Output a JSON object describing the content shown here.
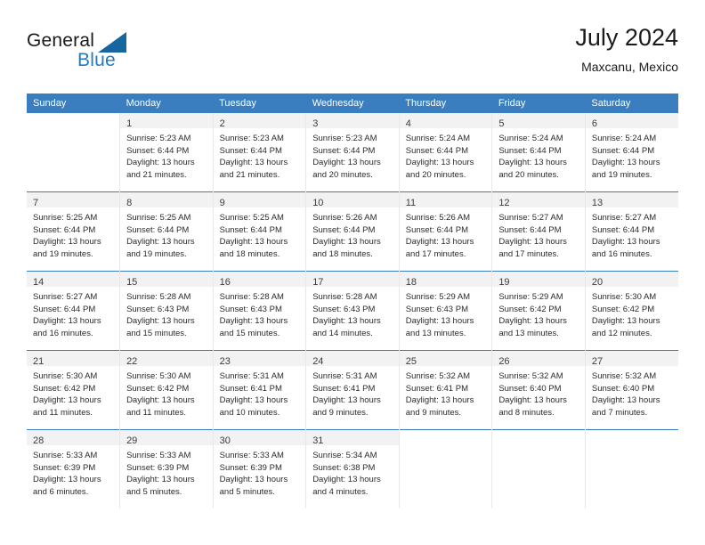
{
  "brand": {
    "name_top": "General",
    "name_bottom": "Blue",
    "accent_color": "#15659e",
    "blue_text_color": "#1f7ac4"
  },
  "header": {
    "title": "July 2024",
    "subtitle": "Maxcanu, Mexico"
  },
  "theme": {
    "header_bg": "#3a7ebf",
    "header_text": "#ffffff",
    "daynum_band_bg": "#f2f2f2",
    "row_divider": "#3a7ebf",
    "cell_divider": "#e8e8e8"
  },
  "calendar": {
    "weekday_headers": [
      "Sunday",
      "Monday",
      "Tuesday",
      "Wednesday",
      "Thursday",
      "Friday",
      "Saturday"
    ],
    "weeks": [
      [
        {
          "blank": true
        },
        {
          "day": "1",
          "sunrise": "Sunrise: 5:23 AM",
          "sunset": "Sunset: 6:44 PM",
          "daylight": "Daylight: 13 hours and 21 minutes."
        },
        {
          "day": "2",
          "sunrise": "Sunrise: 5:23 AM",
          "sunset": "Sunset: 6:44 PM",
          "daylight": "Daylight: 13 hours and 21 minutes."
        },
        {
          "day": "3",
          "sunrise": "Sunrise: 5:23 AM",
          "sunset": "Sunset: 6:44 PM",
          "daylight": "Daylight: 13 hours and 20 minutes."
        },
        {
          "day": "4",
          "sunrise": "Sunrise: 5:24 AM",
          "sunset": "Sunset: 6:44 PM",
          "daylight": "Daylight: 13 hours and 20 minutes."
        },
        {
          "day": "5",
          "sunrise": "Sunrise: 5:24 AM",
          "sunset": "Sunset: 6:44 PM",
          "daylight": "Daylight: 13 hours and 20 minutes."
        },
        {
          "day": "6",
          "sunrise": "Sunrise: 5:24 AM",
          "sunset": "Sunset: 6:44 PM",
          "daylight": "Daylight: 13 hours and 19 minutes."
        }
      ],
      [
        {
          "day": "7",
          "sunrise": "Sunrise: 5:25 AM",
          "sunset": "Sunset: 6:44 PM",
          "daylight": "Daylight: 13 hours and 19 minutes."
        },
        {
          "day": "8",
          "sunrise": "Sunrise: 5:25 AM",
          "sunset": "Sunset: 6:44 PM",
          "daylight": "Daylight: 13 hours and 19 minutes."
        },
        {
          "day": "9",
          "sunrise": "Sunrise: 5:25 AM",
          "sunset": "Sunset: 6:44 PM",
          "daylight": "Daylight: 13 hours and 18 minutes."
        },
        {
          "day": "10",
          "sunrise": "Sunrise: 5:26 AM",
          "sunset": "Sunset: 6:44 PM",
          "daylight": "Daylight: 13 hours and 18 minutes."
        },
        {
          "day": "11",
          "sunrise": "Sunrise: 5:26 AM",
          "sunset": "Sunset: 6:44 PM",
          "daylight": "Daylight: 13 hours and 17 minutes."
        },
        {
          "day": "12",
          "sunrise": "Sunrise: 5:27 AM",
          "sunset": "Sunset: 6:44 PM",
          "daylight": "Daylight: 13 hours and 17 minutes."
        },
        {
          "day": "13",
          "sunrise": "Sunrise: 5:27 AM",
          "sunset": "Sunset: 6:44 PM",
          "daylight": "Daylight: 13 hours and 16 minutes."
        }
      ],
      [
        {
          "day": "14",
          "sunrise": "Sunrise: 5:27 AM",
          "sunset": "Sunset: 6:44 PM",
          "daylight": "Daylight: 13 hours and 16 minutes."
        },
        {
          "day": "15",
          "sunrise": "Sunrise: 5:28 AM",
          "sunset": "Sunset: 6:43 PM",
          "daylight": "Daylight: 13 hours and 15 minutes."
        },
        {
          "day": "16",
          "sunrise": "Sunrise: 5:28 AM",
          "sunset": "Sunset: 6:43 PM",
          "daylight": "Daylight: 13 hours and 15 minutes."
        },
        {
          "day": "17",
          "sunrise": "Sunrise: 5:28 AM",
          "sunset": "Sunset: 6:43 PM",
          "daylight": "Daylight: 13 hours and 14 minutes."
        },
        {
          "day": "18",
          "sunrise": "Sunrise: 5:29 AM",
          "sunset": "Sunset: 6:43 PM",
          "daylight": "Daylight: 13 hours and 13 minutes."
        },
        {
          "day": "19",
          "sunrise": "Sunrise: 5:29 AM",
          "sunset": "Sunset: 6:42 PM",
          "daylight": "Daylight: 13 hours and 13 minutes."
        },
        {
          "day": "20",
          "sunrise": "Sunrise: 5:30 AM",
          "sunset": "Sunset: 6:42 PM",
          "daylight": "Daylight: 13 hours and 12 minutes."
        }
      ],
      [
        {
          "day": "21",
          "sunrise": "Sunrise: 5:30 AM",
          "sunset": "Sunset: 6:42 PM",
          "daylight": "Daylight: 13 hours and 11 minutes."
        },
        {
          "day": "22",
          "sunrise": "Sunrise: 5:30 AM",
          "sunset": "Sunset: 6:42 PM",
          "daylight": "Daylight: 13 hours and 11 minutes."
        },
        {
          "day": "23",
          "sunrise": "Sunrise: 5:31 AM",
          "sunset": "Sunset: 6:41 PM",
          "daylight": "Daylight: 13 hours and 10 minutes."
        },
        {
          "day": "24",
          "sunrise": "Sunrise: 5:31 AM",
          "sunset": "Sunset: 6:41 PM",
          "daylight": "Daylight: 13 hours and 9 minutes."
        },
        {
          "day": "25",
          "sunrise": "Sunrise: 5:32 AM",
          "sunset": "Sunset: 6:41 PM",
          "daylight": "Daylight: 13 hours and 9 minutes."
        },
        {
          "day": "26",
          "sunrise": "Sunrise: 5:32 AM",
          "sunset": "Sunset: 6:40 PM",
          "daylight": "Daylight: 13 hours and 8 minutes."
        },
        {
          "day": "27",
          "sunrise": "Sunrise: 5:32 AM",
          "sunset": "Sunset: 6:40 PM",
          "daylight": "Daylight: 13 hours and 7 minutes."
        }
      ],
      [
        {
          "day": "28",
          "sunrise": "Sunrise: 5:33 AM",
          "sunset": "Sunset: 6:39 PM",
          "daylight": "Daylight: 13 hours and 6 minutes."
        },
        {
          "day": "29",
          "sunrise": "Sunrise: 5:33 AM",
          "sunset": "Sunset: 6:39 PM",
          "daylight": "Daylight: 13 hours and 5 minutes."
        },
        {
          "day": "30",
          "sunrise": "Sunrise: 5:33 AM",
          "sunset": "Sunset: 6:39 PM",
          "daylight": "Daylight: 13 hours and 5 minutes."
        },
        {
          "day": "31",
          "sunrise": "Sunrise: 5:34 AM",
          "sunset": "Sunset: 6:38 PM",
          "daylight": "Daylight: 13 hours and 4 minutes."
        },
        {
          "blank": true
        },
        {
          "blank": true
        },
        {
          "blank": true
        }
      ]
    ]
  }
}
